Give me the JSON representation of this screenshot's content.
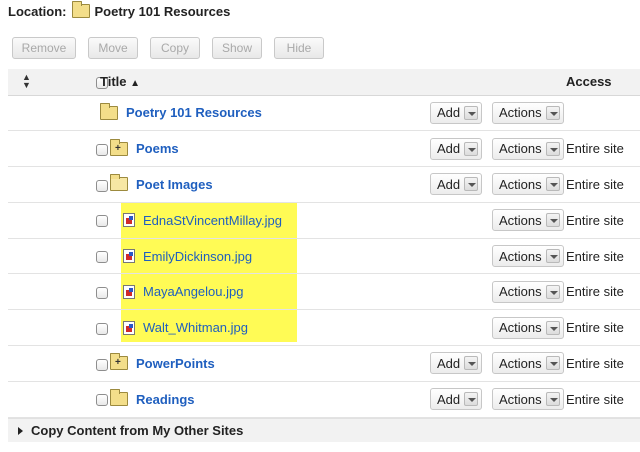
{
  "location": {
    "label": "Location:",
    "value": "Poetry 101 Resources"
  },
  "toolbar": {
    "remove": "Remove",
    "move": "Move",
    "copy": "Copy",
    "show": "Show",
    "hide": "Hide"
  },
  "header": {
    "title": "Title",
    "access": "Access"
  },
  "controls": {
    "add": "Add",
    "actions": "Actions"
  },
  "rows": [
    {
      "name": "Poetry 101 Resources",
      "kind": "folder",
      "indent": 0,
      "access": "",
      "has_checkbox": false,
      "has_add": true
    },
    {
      "name": "Poems",
      "kind": "folder-plus",
      "indent": 1,
      "access": "Entire site",
      "has_checkbox": true,
      "has_add": true
    },
    {
      "name": "Poet Images",
      "kind": "folder-open",
      "indent": 1,
      "access": "Entire site",
      "has_checkbox": true,
      "has_add": true
    },
    {
      "name": "EdnaStVincentMillay.jpg",
      "kind": "file",
      "indent": 2,
      "access": "Entire site",
      "has_checkbox": true,
      "has_add": false
    },
    {
      "name": "EmilyDickinson.jpg",
      "kind": "file",
      "indent": 2,
      "access": "Entire site",
      "has_checkbox": true,
      "has_add": false
    },
    {
      "name": "MayaAngelou.jpg",
      "kind": "file",
      "indent": 2,
      "access": "Entire site",
      "has_checkbox": true,
      "has_add": false
    },
    {
      "name": "Walt_Whitman.jpg",
      "kind": "file",
      "indent": 2,
      "access": "Entire site",
      "has_checkbox": true,
      "has_add": false
    },
    {
      "name": "PowerPoints",
      "kind": "folder-plus",
      "indent": 1,
      "access": "Entire site",
      "has_checkbox": true,
      "has_add": true
    },
    {
      "name": "Readings",
      "kind": "folder",
      "indent": 1,
      "access": "Entire site",
      "has_checkbox": true,
      "has_add": true
    }
  ],
  "footer": {
    "label": "Copy Content from My Other Sites"
  },
  "colors": {
    "link": "#1f5fbf",
    "highlight": "#fffb55",
    "header_bg": "#f2f2f2"
  }
}
